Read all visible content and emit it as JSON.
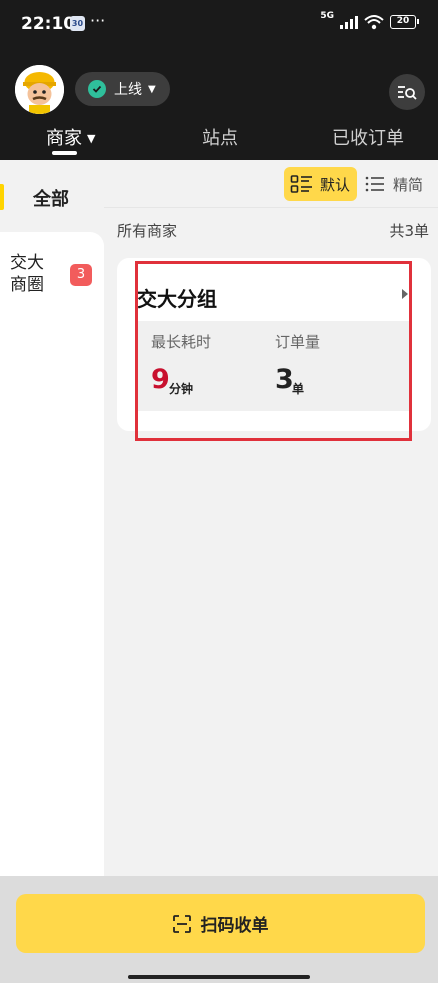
{
  "status_bar": {
    "time": "22:10",
    "calendar_badge": "30",
    "more": "···",
    "network": "5G",
    "battery": "20"
  },
  "header": {
    "online_status": "上线",
    "tabs": [
      {
        "label": "商家",
        "active": true
      },
      {
        "label": "站点",
        "active": false
      },
      {
        "label": "已收订单",
        "active": false
      }
    ]
  },
  "sidebar": {
    "all_label": "全部",
    "items": [
      {
        "label": "交大商圈",
        "badge": "3"
      }
    ]
  },
  "view_toggle": {
    "default_label": "默认",
    "compact_label": "精简"
  },
  "list_header": {
    "section_label": "所有商家",
    "total": "共3单"
  },
  "group_card": {
    "title": "交大分组",
    "stats": [
      {
        "label": "最长耗时",
        "value": "9",
        "unit": "分钟",
        "color": "#c8102e"
      },
      {
        "label": "订单量",
        "value": "3",
        "unit": "单",
        "color": "#222222"
      }
    ]
  },
  "bottom": {
    "scan_label": "扫码收单"
  },
  "colors": {
    "accent": "#ffd84a",
    "header_bg": "#1a1a1a",
    "online_green": "#2fbf9b",
    "badge_red": "#f25c5c",
    "highlight_red": "#e0313b"
  }
}
